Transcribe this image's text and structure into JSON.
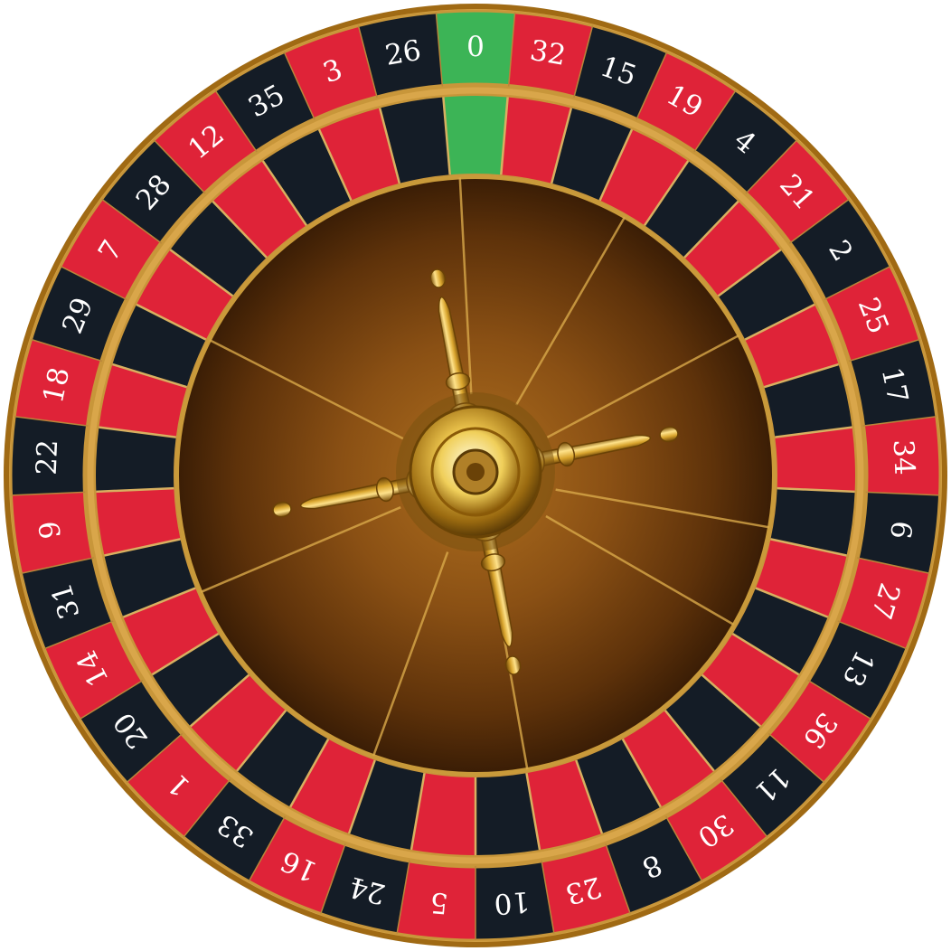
{
  "wheel": {
    "pockets": [
      {
        "number": "0",
        "color": "green"
      },
      {
        "number": "32",
        "color": "red"
      },
      {
        "number": "15",
        "color": "black"
      },
      {
        "number": "19",
        "color": "red"
      },
      {
        "number": "4",
        "color": "black"
      },
      {
        "number": "21",
        "color": "red"
      },
      {
        "number": "2",
        "color": "black"
      },
      {
        "number": "25",
        "color": "red"
      },
      {
        "number": "17",
        "color": "black"
      },
      {
        "number": "34",
        "color": "red"
      },
      {
        "number": "6",
        "color": "black"
      },
      {
        "number": "27",
        "color": "red"
      },
      {
        "number": "13",
        "color": "black"
      },
      {
        "number": "36",
        "color": "red"
      },
      {
        "number": "11",
        "color": "black"
      },
      {
        "number": "30",
        "color": "red"
      },
      {
        "number": "8",
        "color": "black"
      },
      {
        "number": "23",
        "color": "red"
      },
      {
        "number": "10",
        "color": "black"
      },
      {
        "number": "5",
        "color": "red"
      },
      {
        "number": "24",
        "color": "black"
      },
      {
        "number": "16",
        "color": "red"
      },
      {
        "number": "33",
        "color": "black"
      },
      {
        "number": "1",
        "color": "red"
      },
      {
        "number": "20",
        "color": "black"
      },
      {
        "number": "14",
        "color": "red"
      },
      {
        "number": "31",
        "color": "black"
      },
      {
        "number": "9",
        "color": "red"
      },
      {
        "number": "22",
        "color": "black"
      },
      {
        "number": "18",
        "color": "red"
      },
      {
        "number": "29",
        "color": "black"
      },
      {
        "number": "7",
        "color": "red"
      },
      {
        "number": "28",
        "color": "black"
      },
      {
        "number": "12",
        "color": "red"
      },
      {
        "number": "35",
        "color": "black"
      },
      {
        "number": "3",
        "color": "red"
      },
      {
        "number": "26",
        "color": "black"
      }
    ],
    "colors": {
      "red": "#df2338",
      "black": "#141c26",
      "green": "#3cb456",
      "gold": "#b8860b",
      "wood": "#6e3a0c"
    }
  }
}
